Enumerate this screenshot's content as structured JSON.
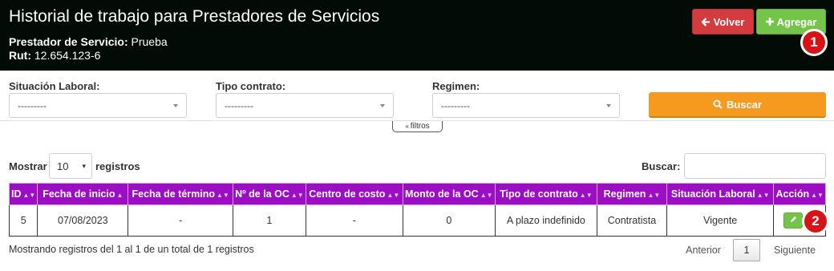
{
  "header": {
    "title": "Historial de trabajo para Prestadores de Servicios",
    "prestador_label": "Prestador de Servicio:",
    "prestador_value": "Prueba",
    "rut_label": "Rut:",
    "rut_value": "12.654.123-6",
    "volver_label": "Volver",
    "agregar_label": "Agregar",
    "marker1": "1"
  },
  "filters": {
    "situacion_label": "Situación Laboral:",
    "situacion_value": "---------",
    "tipo_label": "Tipo contrato:",
    "tipo_value": "---------",
    "regimen_label": "Regimen:",
    "regimen_value": "---------",
    "buscar_button": "Buscar",
    "toggle_label": "filtros"
  },
  "table_controls": {
    "mostrar": "Mostrar",
    "length_value": "10",
    "registros": "registros",
    "buscar_label": "Buscar:"
  },
  "table": {
    "headers": [
      "ID",
      "Fecha de inicio",
      "Fecha de término",
      "Nº de la OC",
      "Centro de costo",
      "Monto de la OC",
      "Tipo de contrato",
      "Regimen",
      "Situación Laboral",
      "Acción"
    ],
    "rows": [
      [
        "5",
        "07/08/2023",
        "-",
        "1",
        "-",
        "0",
        "A plazo indefinido",
        "Contratista",
        "Vigente",
        ""
      ]
    ],
    "marker2": "2"
  },
  "footer": {
    "info": "Mostrando registros del 1 al 1 de un total de 1 registros",
    "prev": "Anterior",
    "page": "1",
    "next": "Siguiente"
  },
  "colors": {
    "header_bg": "#020b05",
    "table_header": "#9b0ec4",
    "volver": "#d33b3f",
    "agregar": "#74c44a",
    "buscar": "#f59a1f",
    "marker": "#d61418"
  },
  "icons": {
    "volver": "arrow-left-icon",
    "agregar": "plus-icon",
    "buscar": "search-icon",
    "edit": "pencil-icon",
    "filtros": "double-chevron-up-icon"
  }
}
